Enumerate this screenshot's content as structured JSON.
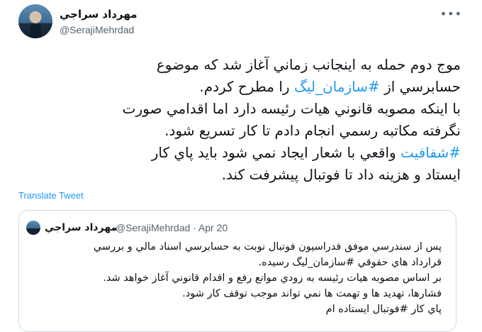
{
  "tweet": {
    "author_name": "مهرداد سراجي",
    "author_handle": "@SerajiMehrdad",
    "more_icon": "more-options-icon",
    "lines": [
      {
        "parts": [
          {
            "t": "موج دوم حمله به اينجانب زماني آغاز شد كه موضوع"
          }
        ]
      },
      {
        "parts": [
          {
            "t": "حسابرسي از "
          },
          {
            "t": "#سازمان_ليگ",
            "tag": true
          },
          {
            "t": " را مطرح كردم."
          }
        ]
      },
      {
        "parts": [
          {
            "t": "با اينكه مصوبه قانوني هيات رئيسه دارد اما اقدامي صورت"
          }
        ]
      },
      {
        "parts": [
          {
            "t": "نگرفته مكاتبه رسمي انجام دادم تا كار تسريع شود."
          }
        ]
      },
      {
        "parts": [
          {
            "t": "#شفافيت",
            "tag": true
          },
          {
            "t": " واقعي با شعار ايجاد نمي شود بايد پاي كار"
          }
        ]
      },
      {
        "parts": [
          {
            "t": "ايستاد و هزينه داد تا فوتبال پيشرفت كند."
          }
        ]
      }
    ],
    "translate_label": "Translate Tweet"
  },
  "quote": {
    "author_name": "مهرداد سراجي",
    "author_handle": "@SerajiMehrdad · Apr 20",
    "lines": [
      "پس از سندرسي موفق فدراسيون فوتبال نوبت به حسابرسي اسناد مالي و بررسي",
      "قرارداد هاي حقوقي #سازمان_ليگ رسيده.",
      "بر اساس مصوبه هيات رئيسه به زودي موانع رفع و اقدام قانوني آغاز خواهد شد.",
      "فشارها، تهديد ها و تهمت ها نمي تواند موجب توقف كار شود.",
      "پاي كار #فوتبال ايستاده ام"
    ]
  },
  "colors": {
    "link": "#1d9bf0",
    "muted": "#536471",
    "text": "#0f1419",
    "border": "#cfd9de"
  }
}
